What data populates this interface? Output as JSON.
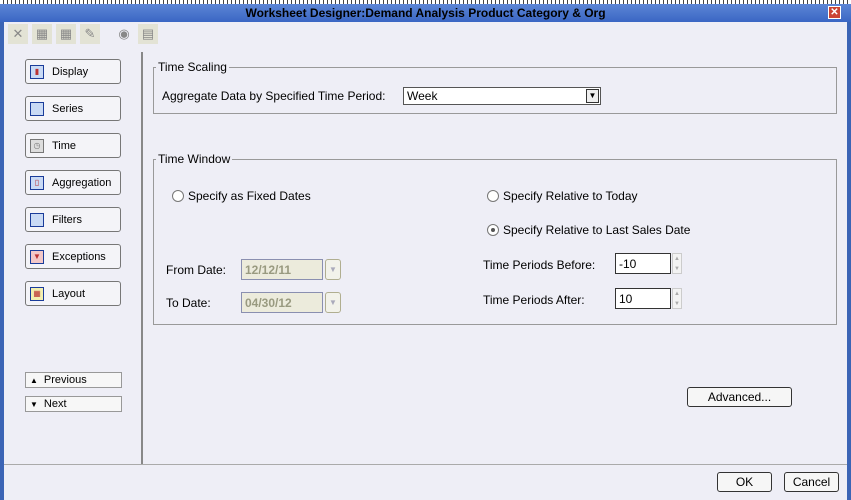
{
  "window": {
    "title": "Worksheet Designer:Demand Analysis Product Category & Org"
  },
  "toolbar": {
    "icons": [
      "delete-icon",
      "table-icon",
      "table-export-icon",
      "edit-icon",
      "preview-icon",
      "settings-icon"
    ]
  },
  "sidebar": {
    "items": [
      {
        "label": "Display",
        "icon": "chart-icon"
      },
      {
        "label": "Series",
        "icon": "series-icon"
      },
      {
        "label": "Time",
        "icon": "clock-icon"
      },
      {
        "label": "Aggregation",
        "icon": "aggregation-icon"
      },
      {
        "label": "Filters",
        "icon": "filter-icon"
      },
      {
        "label": "Exceptions",
        "icon": "exceptions-icon"
      },
      {
        "label": "Layout",
        "icon": "layout-icon"
      }
    ],
    "previous": "Previous",
    "next": "Next"
  },
  "time_scaling": {
    "legend": "Time Scaling",
    "label": "Aggregate Data by Specified Time Period:",
    "value": "Week"
  },
  "time_window": {
    "legend": "Time Window",
    "fixed": "Specify as Fixed Dates",
    "relative_today": "Specify Relative to Today",
    "relative_last_sales": "Specify Relative to Last Sales Date",
    "selected": "relative_last_sales",
    "from_label": "From Date:",
    "from_value": "12/12/11",
    "to_label": "To Date:",
    "to_value": "04/30/12",
    "before_label": "Time Periods Before:",
    "before_value": "-10",
    "after_label": "Time Periods After:",
    "after_value": "10"
  },
  "buttons": {
    "advanced": "Advanced...",
    "ok": "OK",
    "cancel": "Cancel"
  }
}
